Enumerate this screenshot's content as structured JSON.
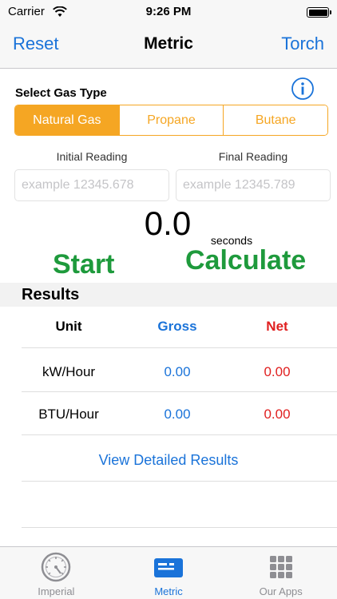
{
  "status": {
    "carrier": "Carrier",
    "time": "9:26 PM"
  },
  "nav": {
    "left": "Reset",
    "title": "Metric",
    "right": "Torch"
  },
  "gas": {
    "label": "Select Gas Type",
    "options": [
      "Natural Gas",
      "Propane",
      "Butane"
    ],
    "selected": "Natural Gas"
  },
  "readings": {
    "initial_label": "Initial Reading",
    "final_label": "Final Reading",
    "initial_placeholder": "example 12345.678",
    "final_placeholder": "example 12345.789"
  },
  "timer": {
    "value": "0.0",
    "unit": "seconds"
  },
  "actions": {
    "start": "Start",
    "calculate": "Calculate"
  },
  "results": {
    "title": "Results",
    "headers": {
      "unit": "Unit",
      "gross": "Gross",
      "net": "Net"
    },
    "rows": [
      {
        "unit": "kW/Hour",
        "gross": "0.00",
        "net": "0.00"
      },
      {
        "unit": "BTU/Hour",
        "gross": "0.00",
        "net": "0.00"
      }
    ],
    "detail_link": "View Detailed Results"
  },
  "tabs": [
    {
      "label": "Imperial",
      "icon": "gauge-icon"
    },
    {
      "label": "Metric",
      "icon": "card-icon",
      "active": true
    },
    {
      "label": "Our Apps",
      "icon": "grid-icon"
    }
  ],
  "colors": {
    "accent_blue": "#1a73d9",
    "segment_orange": "#f5a623",
    "action_green": "#1e9a3c",
    "net_red": "#e02020"
  }
}
